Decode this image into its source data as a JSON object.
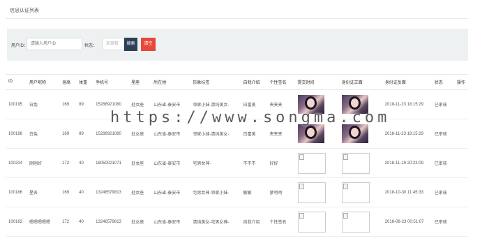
{
  "page": {
    "title": "信息认证列表"
  },
  "filters": {
    "user_id_label": "用户ID：",
    "user_id_placeholder": "请输入用户ID",
    "status_label": "状态：",
    "status_selected": "未审核",
    "search_label": "搜索",
    "clear_label": "清空"
  },
  "table": {
    "headers": [
      "ID",
      "用户昵称",
      "身高",
      "体重",
      "手机号",
      "星座",
      "所在地",
      "形象标签",
      "自我介绍",
      "个性签名",
      "提交时间",
      "身份证正面",
      "身份证反面",
      "状态",
      "操作"
    ],
    "rows": [
      [
        "100195",
        "白兔",
        "169",
        "89",
        "15288921080",
        "处女座",
        "山东省-泰安市",
        "邻家小妹-清纯美女-",
        "白富美",
        "夹夹夹",
        "",
        "",
        "2018-11-23 18:15:29",
        "已审核",
        ""
      ],
      [
        "100188",
        "白兔",
        "169",
        "89",
        "15288921080",
        "处女座",
        "山东省-泰安市",
        "邻家小妹-清纯美女-",
        "白富美",
        "夹夹夹",
        "",
        "",
        "2018-11-23 18:15:29",
        "已审核",
        ""
      ],
      [
        "100204",
        "刚刚好",
        "172",
        "40",
        "18050021071",
        "处女座",
        "山东省-泰安市",
        "宅男女神-",
        "不不不",
        "好好",
        "",
        "",
        "2018-11-19 20:23:09",
        "已审核",
        ""
      ],
      [
        "100186",
        "星名",
        "169",
        "40",
        "13246579813",
        "处女座",
        "山东省-泰安市",
        "宅男女神-邻家小妹-",
        "敏敏",
        "萝呵呵",
        "",
        "",
        "2018-10-30 11:45:33",
        "已审核",
        ""
      ],
      [
        "100163",
        "嗯嗯嗯嗯嗯",
        "172",
        "40",
        "13246579813",
        "处女座",
        "山东省-泰安市",
        "清纯美女-宅男女神-",
        "自我介绍",
        "个性签名",
        "",
        "",
        "2018-08-23 00:51:07",
        "已审核",
        ""
      ]
    ],
    "photos": [
      [
        "real",
        "real"
      ],
      [
        "real",
        "real"
      ],
      [
        "broken",
        "broken"
      ],
      [
        "broken",
        "broken"
      ],
      [
        "broken",
        "broken"
      ]
    ]
  },
  "watermark": "https://www.songma.com"
}
